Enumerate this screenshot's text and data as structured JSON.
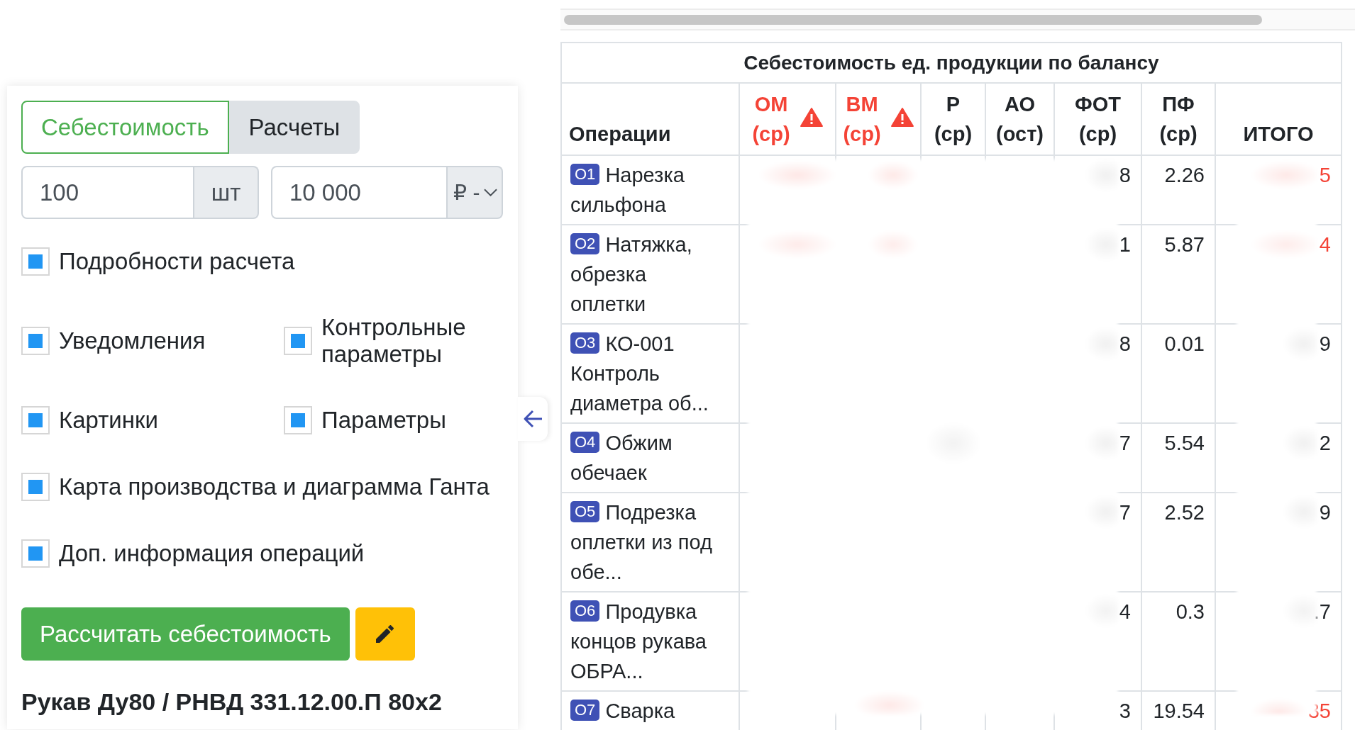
{
  "settings_panel": {
    "tabs": [
      {
        "label": "Себестоимость",
        "selected": true
      },
      {
        "label": "Расчеты",
        "selected": false
      }
    ],
    "quantity": {
      "value": "100",
      "unit": "шт"
    },
    "price": {
      "value": "10 000",
      "currency": "₽ -"
    },
    "option_rows": [
      {
        "items": [
          {
            "label": "Подробности расчета",
            "checked": true
          }
        ]
      },
      {
        "items": [
          {
            "label": "Уведомления",
            "checked": true
          },
          {
            "label": "Контрольные параметры",
            "checked": true
          }
        ]
      },
      {
        "items": [
          {
            "label": "Картинки",
            "checked": true
          },
          {
            "label": "Параметры",
            "checked": true
          }
        ]
      },
      {
        "items": [
          {
            "label": "Карта производства и диаграмма Ганта",
            "checked": true
          }
        ]
      },
      {
        "items": [
          {
            "label": "Доп. информация операций",
            "checked": true
          }
        ]
      }
    ],
    "calculate_button": "Рассчитать себестоимость",
    "product_title": "Рукав Ду80 / РНВД 331.12.00.П 80x2"
  },
  "table": {
    "title": "Себестоимость ед. продукции по балансу",
    "columns": [
      {
        "label": "Операции",
        "warning": false
      },
      {
        "label": "ОМ (ср)",
        "warning": true
      },
      {
        "label": "ВМ (ср)",
        "warning": true
      },
      {
        "label": "Р (ср)",
        "warning": false
      },
      {
        "label": "АО (ост)",
        "warning": false
      },
      {
        "label": "ФОТ (ср)",
        "warning": false
      },
      {
        "label": "ПФ (ср)",
        "warning": false
      },
      {
        "label": "ИТОГО",
        "warning": false
      }
    ],
    "rows": [
      {
        "badge": "О1",
        "operation": "Нарезка сильфона",
        "fot": {
          "text": "8",
          "alert": false
        },
        "pf": {
          "text": "2.26",
          "alert": false
        },
        "total": {
          "text": "5",
          "alert": true
        }
      },
      {
        "badge": "О2",
        "operation": "Натяжка, обрезка оплетки",
        "fot": {
          "text": "1",
          "alert": false
        },
        "pf": {
          "text": "5.87",
          "alert": false
        },
        "total": {
          "text": "4",
          "alert": true
        }
      },
      {
        "badge": "О3",
        "operation": "КО-001 Контроль диаметра об...",
        "fot": {
          "text": "8",
          "alert": false
        },
        "pf": {
          "text": "0.01",
          "alert": false
        },
        "total": {
          "text": "9",
          "alert": false
        }
      },
      {
        "badge": "О4",
        "operation": "Обжим обечаек",
        "fot": {
          "text": "7",
          "alert": false
        },
        "pf": {
          "text": "5.54",
          "alert": false
        },
        "total": {
          "text": "2",
          "alert": false
        }
      },
      {
        "badge": "О5",
        "operation": "Подрезка оплетки из под обе...",
        "fot": {
          "text": "7",
          "alert": false
        },
        "pf": {
          "text": "2.52",
          "alert": false
        },
        "total": {
          "text": "9",
          "alert": false
        }
      },
      {
        "badge": "О6",
        "operation": "Продувка концов рукава ОБРА...",
        "fot": {
          "text": "4",
          "alert": false
        },
        "pf": {
          "text": "0.3",
          "alert": false
        },
        "total": {
          "text": ".7",
          "alert": false
        }
      },
      {
        "badge": "О7",
        "operation": "Сварка",
        "fot": {
          "text": "3",
          "alert": false
        },
        "pf": {
          "text": "19.54",
          "alert": false
        },
        "total": {
          "text": "35",
          "alert": true
        }
      }
    ]
  }
}
